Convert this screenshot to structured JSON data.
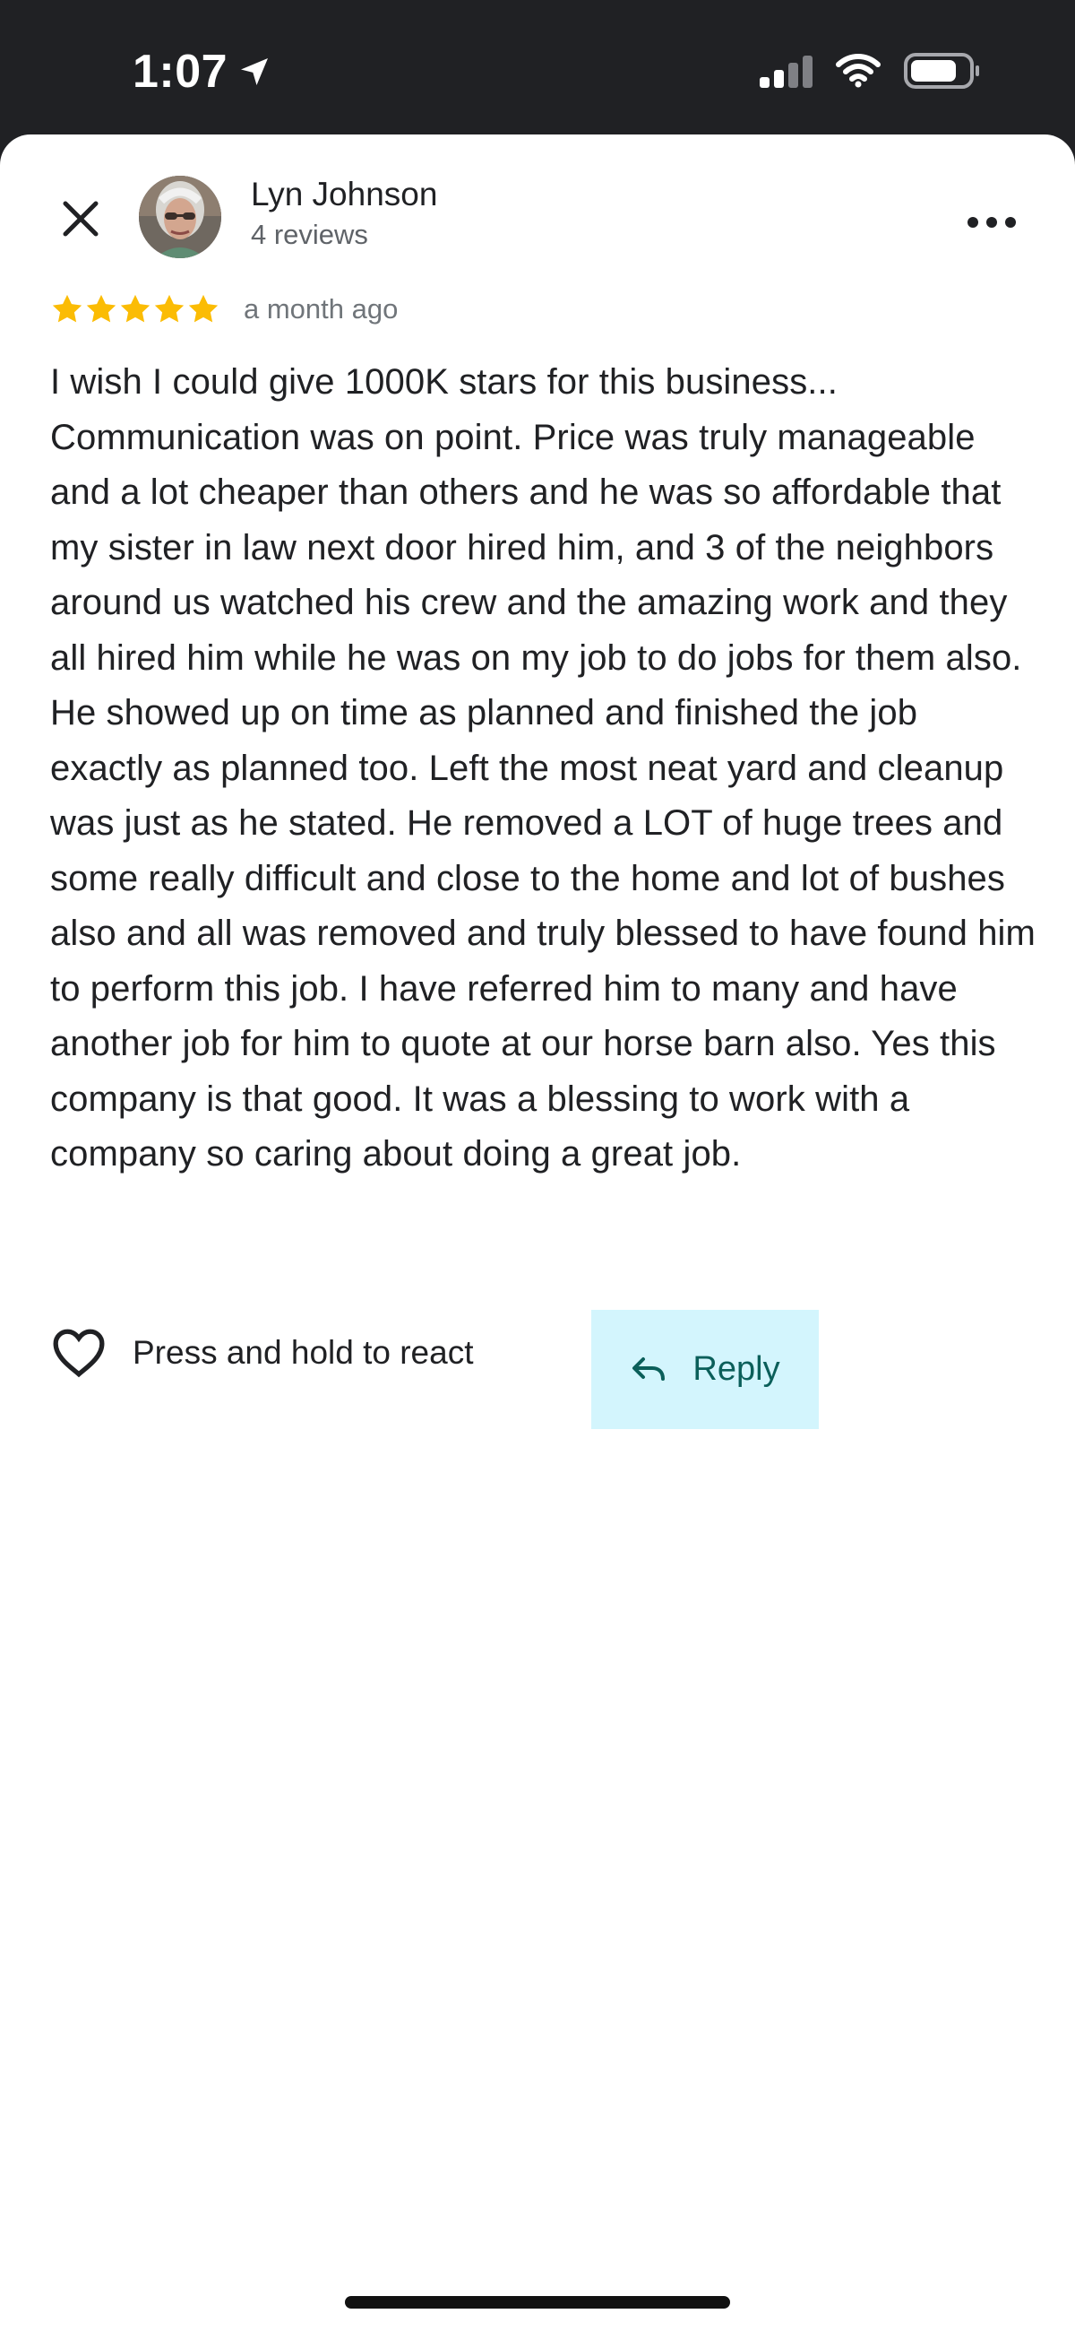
{
  "status_bar": {
    "time": "1:07",
    "location_icon": "location-arrow-icon",
    "signal_icon": "cellular-signal-icon",
    "wifi_icon": "wifi-icon",
    "battery_icon": "battery-icon"
  },
  "header": {
    "close_icon": "close-icon",
    "author_name": "Lyn Johnson",
    "review_count": "4 reviews",
    "more_icon": "more-options-icon"
  },
  "review": {
    "rating": 5,
    "max_rating": 5,
    "star_color": "#fbbc04",
    "date": "a month ago",
    "text": "I wish I could give 1000K stars for this business... Communication was on point. Price was truly manageable and a lot cheaper than others and he was so affordable that my sister in law next door hired him, and 3 of the neighbors around us watched his crew and the amazing work and they all hired him while he was on my job to do jobs for them also. He showed up on time as planned and finished the job exactly as planned too. Left the most neat yard and cleanup was just as he stated. He removed a LOT of huge trees and some really difficult and close to the home and lot of bushes also and all was removed and truly blessed to have found him to perform this job. I have referred him to many and have another job for him to quote at our horse barn also. Yes this company is that good. It was a blessing to work with a company so caring about doing a great job."
  },
  "actions": {
    "react_label": "Press and hold to react",
    "react_icon": "heart-icon",
    "reply_label": "Reply",
    "reply_icon": "reply-arrow-icon",
    "reply_background": "#d3f5fd",
    "reply_color": "#0b5f5a"
  }
}
